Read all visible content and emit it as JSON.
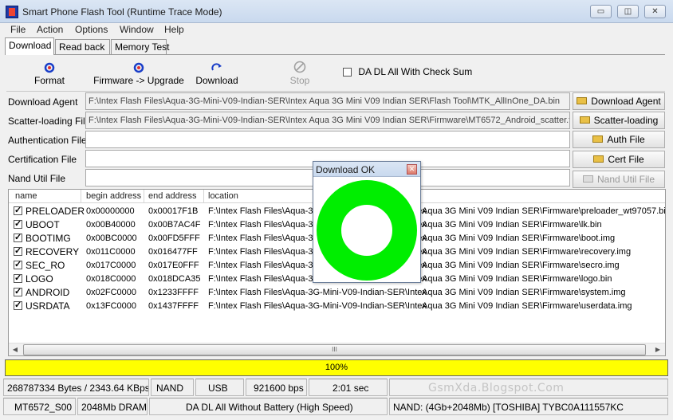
{
  "window": {
    "title": "Smart Phone Flash Tool (Runtime Trace Mode)",
    "min_glyph": "▭",
    "max_glyph": "◫",
    "close_glyph": "✕"
  },
  "menu": [
    "File",
    "Action",
    "Options",
    "Window",
    "Help"
  ],
  "tabs": [
    "Download",
    "Read back",
    "Memory Test"
  ],
  "toolbar": {
    "format": "Format",
    "firmware_upgrade": "Firmware -> Upgrade",
    "download": "Download",
    "stop": "Stop",
    "checksum_label": "DA DL All With Check Sum",
    "checksum_checked": false
  },
  "files": {
    "download_agent": {
      "label": "Download Agent",
      "value": "F:\\Intex Flash Files\\Aqua-3G-Mini-V09-Indian-SER\\Intex Aqua 3G Mini V09 Indian SER\\Flash Tool\\MTK_AllInOne_DA.bin",
      "button": "Download Agent"
    },
    "scatter": {
      "label": "Scatter-loading File",
      "value": "F:\\Intex Flash Files\\Aqua-3G-Mini-V09-Indian-SER\\Intex Aqua 3G Mini V09 Indian SER\\Firmware\\MT6572_Android_scatter.txt",
      "button": "Scatter-loading"
    },
    "auth": {
      "label": "Authentication File",
      "value": "",
      "button": "Auth File"
    },
    "cert": {
      "label": "Certification File",
      "value": "",
      "button": "Cert File"
    },
    "nand": {
      "label": "Nand Util File",
      "value": "",
      "button": "Nand Util File"
    }
  },
  "list": {
    "headers": {
      "name": "name",
      "begin": "begin address",
      "end": "end address",
      "location": "location"
    },
    "rows": [
      {
        "name": "PRELOADER",
        "begin": "0x00000000",
        "end": "0x00017F1B",
        "loc_left": "F:\\Intex Flash Files\\Aqua-3G-Mini-V09-Indian-SER\\Intex",
        "loc_right": "Aqua 3G Mini V09 Indian SER\\Firmware\\preloader_wt97057.bin",
        "checked": true
      },
      {
        "name": "UBOOT",
        "begin": "0x00B40000",
        "end": "0x00B7AC4F",
        "loc_left": "F:\\Intex Flash Files\\Aqua-3G-Mini-V09-Indian-SER\\Intex",
        "loc_right": "Aqua 3G Mini V09 Indian SER\\Firmware\\lk.bin",
        "checked": true
      },
      {
        "name": "BOOTIMG",
        "begin": "0x00BC0000",
        "end": "0x00FD5FFF",
        "loc_left": "F:\\Intex Flash Files\\Aqua-3G-Mini-V09-Indian-SER\\Intex",
        "loc_right": "Aqua 3G Mini V09 Indian SER\\Firmware\\boot.img",
        "checked": true
      },
      {
        "name": "RECOVERY",
        "begin": "0x011C0000",
        "end": "0x016477FF",
        "loc_left": "F:\\Intex Flash Files\\Aqua-3G-Mini-V09-Indian-SER\\Intex",
        "loc_right": "Aqua 3G Mini V09 Indian SER\\Firmware\\recovery.img",
        "checked": true
      },
      {
        "name": "SEC_RO",
        "begin": "0x017C0000",
        "end": "0x017E0FFF",
        "loc_left": "F:\\Intex Flash Files\\Aqua-3G-Mini-V09-Indian-SER\\Intex",
        "loc_right": "Aqua 3G Mini V09 Indian SER\\Firmware\\secro.img",
        "checked": true
      },
      {
        "name": "LOGO",
        "begin": "0x018C0000",
        "end": "0x018DCA35",
        "loc_left": "F:\\Intex Flash Files\\Aqua-3G-Mini-V09-Indian-SER\\Intex",
        "loc_right": "Aqua 3G Mini V09 Indian SER\\Firmware\\logo.bin",
        "checked": true
      },
      {
        "name": "ANDROID",
        "begin": "0x02FC0000",
        "end": "0x1233FFFF",
        "loc_left": "F:\\Intex Flash Files\\Aqua-3G-Mini-V09-Indian-SER\\Intex",
        "loc_right": "Aqua 3G Mini V09 Indian SER\\Firmware\\system.img",
        "checked": true
      },
      {
        "name": "USRDATA",
        "begin": "0x13FC0000",
        "end": "0x1437FFFF",
        "loc_left": "F:\\Intex Flash Files\\Aqua-3G-Mini-V09-Indian-SER\\Intex",
        "loc_right": "Aqua 3G Mini V09 Indian SER\\Firmware\\userdata.img",
        "checked": true
      }
    ],
    "scroll_left": "◀",
    "scroll_right": "▶",
    "scroll_grip": "III"
  },
  "progress": {
    "percent": 100,
    "label": "100%",
    "fill_color": "#ffff00"
  },
  "status1": {
    "bytes": "268787334 Bytes / 2343.64 KBps",
    "storage": "NAND",
    "port": "USB",
    "baud": "921600 bps",
    "time": "2:01 sec"
  },
  "status2": {
    "chip": "MT6572_S00",
    "dram": "2048Mb DRAM",
    "mode": "DA DL All Without Battery (High Speed)",
    "nand": "NAND: (4Gb+2048Mb) [TOSHIBA] TYBC0A111557KC"
  },
  "watermark": "GsmXda.Blogspot.Com",
  "dialog": {
    "title": "Download OK",
    "close": "✕",
    "ring_color": "#00ee00"
  }
}
